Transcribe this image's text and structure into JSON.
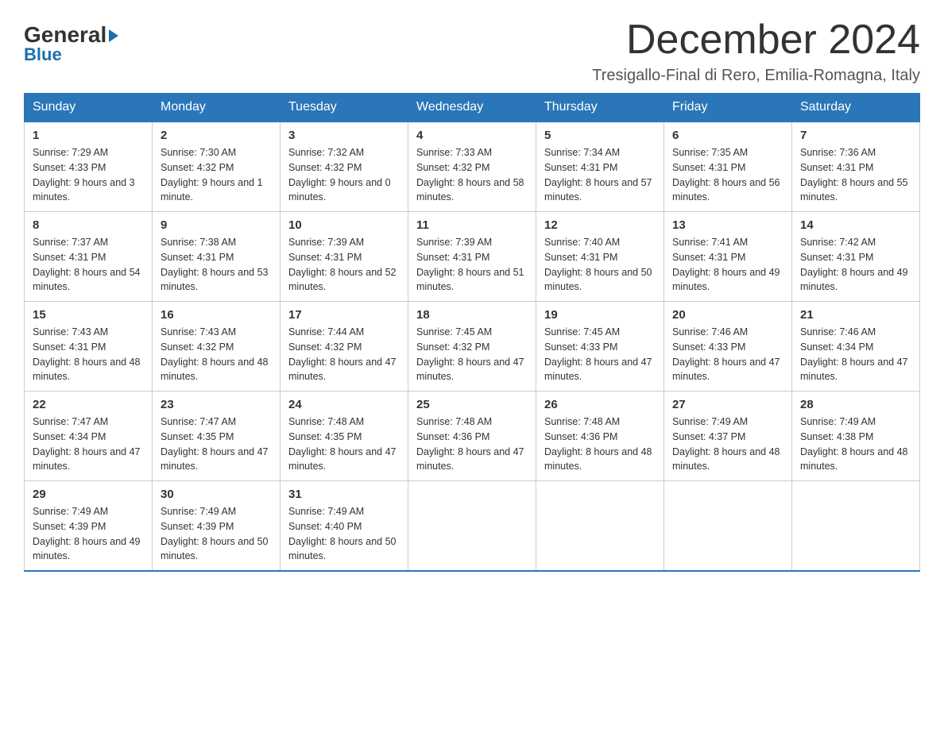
{
  "header": {
    "logo_general": "General",
    "logo_blue": "Blue",
    "month_title": "December 2024",
    "location": "Tresigallo-Final di Rero, Emilia-Romagna, Italy"
  },
  "days_of_week": [
    "Sunday",
    "Monday",
    "Tuesday",
    "Wednesday",
    "Thursday",
    "Friday",
    "Saturday"
  ],
  "weeks": [
    [
      {
        "day": "1",
        "sunrise": "7:29 AM",
        "sunset": "4:33 PM",
        "daylight": "9 hours and 3 minutes."
      },
      {
        "day": "2",
        "sunrise": "7:30 AM",
        "sunset": "4:32 PM",
        "daylight": "9 hours and 1 minute."
      },
      {
        "day": "3",
        "sunrise": "7:32 AM",
        "sunset": "4:32 PM",
        "daylight": "9 hours and 0 minutes."
      },
      {
        "day": "4",
        "sunrise": "7:33 AM",
        "sunset": "4:32 PM",
        "daylight": "8 hours and 58 minutes."
      },
      {
        "day": "5",
        "sunrise": "7:34 AM",
        "sunset": "4:31 PM",
        "daylight": "8 hours and 57 minutes."
      },
      {
        "day": "6",
        "sunrise": "7:35 AM",
        "sunset": "4:31 PM",
        "daylight": "8 hours and 56 minutes."
      },
      {
        "day": "7",
        "sunrise": "7:36 AM",
        "sunset": "4:31 PM",
        "daylight": "8 hours and 55 minutes."
      }
    ],
    [
      {
        "day": "8",
        "sunrise": "7:37 AM",
        "sunset": "4:31 PM",
        "daylight": "8 hours and 54 minutes."
      },
      {
        "day": "9",
        "sunrise": "7:38 AM",
        "sunset": "4:31 PM",
        "daylight": "8 hours and 53 minutes."
      },
      {
        "day": "10",
        "sunrise": "7:39 AM",
        "sunset": "4:31 PM",
        "daylight": "8 hours and 52 minutes."
      },
      {
        "day": "11",
        "sunrise": "7:39 AM",
        "sunset": "4:31 PM",
        "daylight": "8 hours and 51 minutes."
      },
      {
        "day": "12",
        "sunrise": "7:40 AM",
        "sunset": "4:31 PM",
        "daylight": "8 hours and 50 minutes."
      },
      {
        "day": "13",
        "sunrise": "7:41 AM",
        "sunset": "4:31 PM",
        "daylight": "8 hours and 49 minutes."
      },
      {
        "day": "14",
        "sunrise": "7:42 AM",
        "sunset": "4:31 PM",
        "daylight": "8 hours and 49 minutes."
      }
    ],
    [
      {
        "day": "15",
        "sunrise": "7:43 AM",
        "sunset": "4:31 PM",
        "daylight": "8 hours and 48 minutes."
      },
      {
        "day": "16",
        "sunrise": "7:43 AM",
        "sunset": "4:32 PM",
        "daylight": "8 hours and 48 minutes."
      },
      {
        "day": "17",
        "sunrise": "7:44 AM",
        "sunset": "4:32 PM",
        "daylight": "8 hours and 47 minutes."
      },
      {
        "day": "18",
        "sunrise": "7:45 AM",
        "sunset": "4:32 PM",
        "daylight": "8 hours and 47 minutes."
      },
      {
        "day": "19",
        "sunrise": "7:45 AM",
        "sunset": "4:33 PM",
        "daylight": "8 hours and 47 minutes."
      },
      {
        "day": "20",
        "sunrise": "7:46 AM",
        "sunset": "4:33 PM",
        "daylight": "8 hours and 47 minutes."
      },
      {
        "day": "21",
        "sunrise": "7:46 AM",
        "sunset": "4:34 PM",
        "daylight": "8 hours and 47 minutes."
      }
    ],
    [
      {
        "day": "22",
        "sunrise": "7:47 AM",
        "sunset": "4:34 PM",
        "daylight": "8 hours and 47 minutes."
      },
      {
        "day": "23",
        "sunrise": "7:47 AM",
        "sunset": "4:35 PM",
        "daylight": "8 hours and 47 minutes."
      },
      {
        "day": "24",
        "sunrise": "7:48 AM",
        "sunset": "4:35 PM",
        "daylight": "8 hours and 47 minutes."
      },
      {
        "day": "25",
        "sunrise": "7:48 AM",
        "sunset": "4:36 PM",
        "daylight": "8 hours and 47 minutes."
      },
      {
        "day": "26",
        "sunrise": "7:48 AM",
        "sunset": "4:36 PM",
        "daylight": "8 hours and 48 minutes."
      },
      {
        "day": "27",
        "sunrise": "7:49 AM",
        "sunset": "4:37 PM",
        "daylight": "8 hours and 48 minutes."
      },
      {
        "day": "28",
        "sunrise": "7:49 AM",
        "sunset": "4:38 PM",
        "daylight": "8 hours and 48 minutes."
      }
    ],
    [
      {
        "day": "29",
        "sunrise": "7:49 AM",
        "sunset": "4:39 PM",
        "daylight": "8 hours and 49 minutes."
      },
      {
        "day": "30",
        "sunrise": "7:49 AM",
        "sunset": "4:39 PM",
        "daylight": "8 hours and 50 minutes."
      },
      {
        "day": "31",
        "sunrise": "7:49 AM",
        "sunset": "4:40 PM",
        "daylight": "8 hours and 50 minutes."
      },
      null,
      null,
      null,
      null
    ]
  ]
}
